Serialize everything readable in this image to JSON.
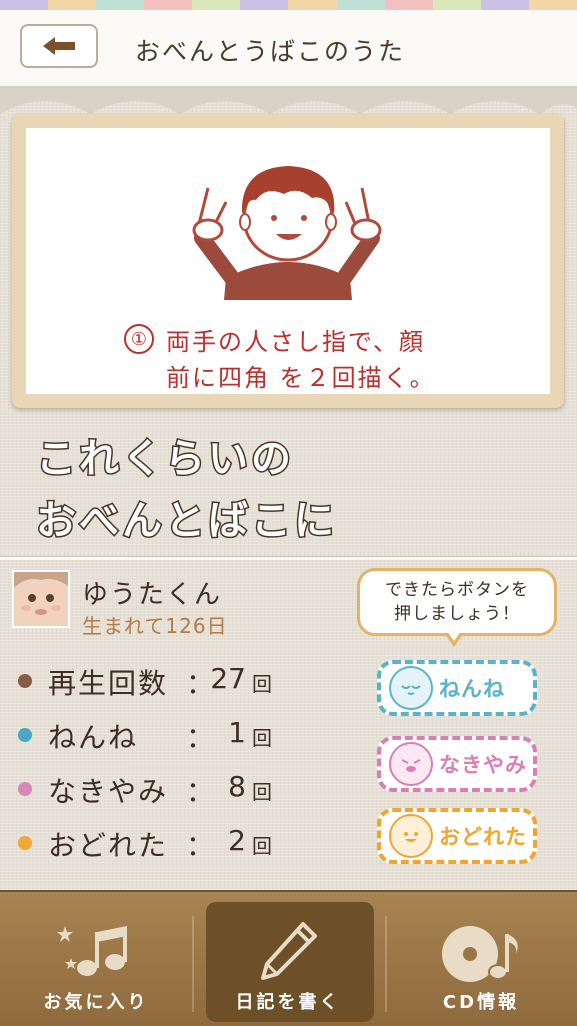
{
  "header": {
    "title": "おべんとうばこのうた"
  },
  "instruction": {
    "step_number": "①",
    "line1": "両手の人さし指で、顔",
    "line2": "前に四角 を２回描く。"
  },
  "lyric": {
    "line1": "これくらいの",
    "line2": "おべんとばこに"
  },
  "child": {
    "name": "ゆうたくん",
    "age_text": "生まれて126日"
  },
  "stats": [
    {
      "label": "再生回数",
      "value": "27",
      "unit": "回",
      "color": "#8a5a48"
    },
    {
      "label": "ねんね",
      "value": "1",
      "unit": "回",
      "color": "#4aa8c4"
    },
    {
      "label": "なきやみ",
      "value": "8",
      "unit": "回",
      "color": "#d888b8"
    },
    {
      "label": "おどれた",
      "value": "2",
      "unit": "回",
      "color": "#f0a838"
    }
  ],
  "tooltip": {
    "line1": "できたらボタンを",
    "line2": "押しましょう！"
  },
  "mood_buttons": [
    {
      "label": "ねんね",
      "color": "#5bb3c9",
      "icon": "sleeping-baby-icon"
    },
    {
      "label": "なきやみ",
      "color": "#d97fb6",
      "icon": "crying-baby-icon"
    },
    {
      "label": "おどれた",
      "color": "#f0a530",
      "icon": "dancing-baby-icon"
    }
  ],
  "tabs": [
    {
      "label": "お気に入り",
      "icon": "favorite-notes-icon"
    },
    {
      "label": "日記を書く",
      "icon": "pencil-icon"
    },
    {
      "label": "CD情報",
      "icon": "cd-icon"
    }
  ]
}
